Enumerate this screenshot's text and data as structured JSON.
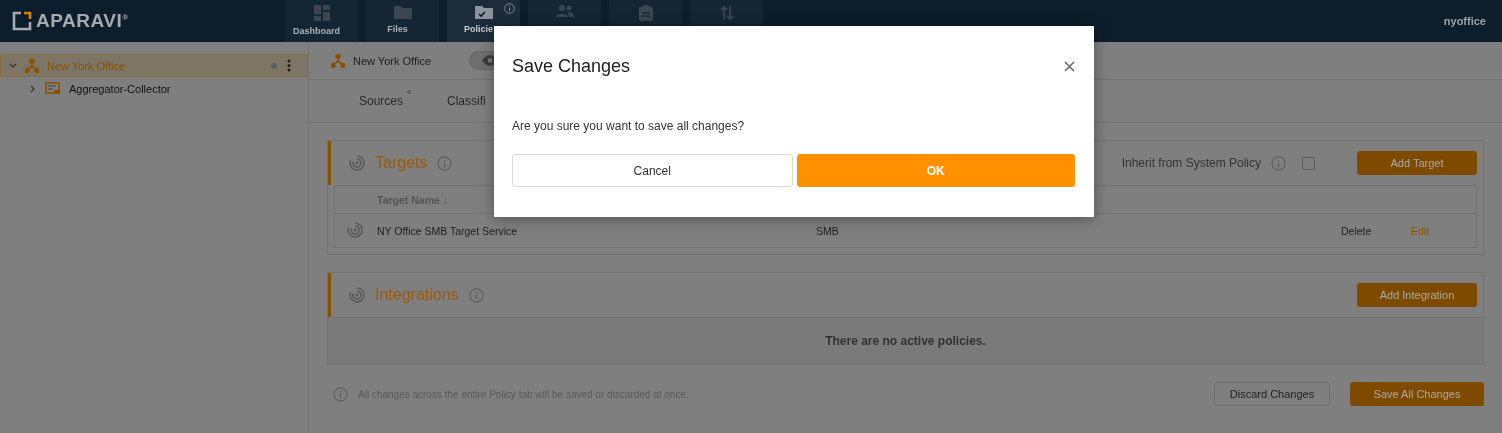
{
  "header": {
    "logo": "APARAVI$^{®}$",
    "nav": [
      {
        "label": "Dashboard",
        "selected": false
      },
      {
        "label": "Files",
        "selected": false
      },
      {
        "label": "Policie",
        "selected": true
      },
      {
        "selected": false
      },
      {
        "selected": false
      },
      {
        "selected": false
      }
    ],
    "user": "nyoffice"
  },
  "sidebar": {
    "tree": [
      {
        "label": "New York Office",
        "expanded": true,
        "selected": true,
        "children": [
          {
            "label": "Aggregator-Collector",
            "expanded": false,
            "selected": false
          }
        ]
      }
    ]
  },
  "breadcrumb": {
    "label": "New York Office",
    "view_on": true
  },
  "tabs": [
    {
      "label": "Sources",
      "modified": true
    },
    {
      "label": "Classifi",
      "modified": false
    }
  ],
  "targets": {
    "title": "Targets",
    "inherit_label": "Inherit from System Policy",
    "inherit_checked": false,
    "add_button": "Add Target",
    "columns": [
      "Target Name ↓"
    ],
    "rows": [
      {
        "name": "NY Office SMB Target Service",
        "type": "SMB",
        "actions": [
          "Delete",
          "Edit"
        ]
      }
    ]
  },
  "integrations": {
    "title": "Integrations",
    "add_button": "Add Integration",
    "empty": "There are no active policies."
  },
  "footer": {
    "note": "All changes across the entire Policy tab will be saved or discarded at once.",
    "discard": "Discard Changes",
    "save": "Save All Changes"
  },
  "dialog": {
    "title": "Save Changes",
    "message": "Are you sure you want to save all changes?",
    "cancel": "Cancel",
    "ok": "OK"
  }
}
